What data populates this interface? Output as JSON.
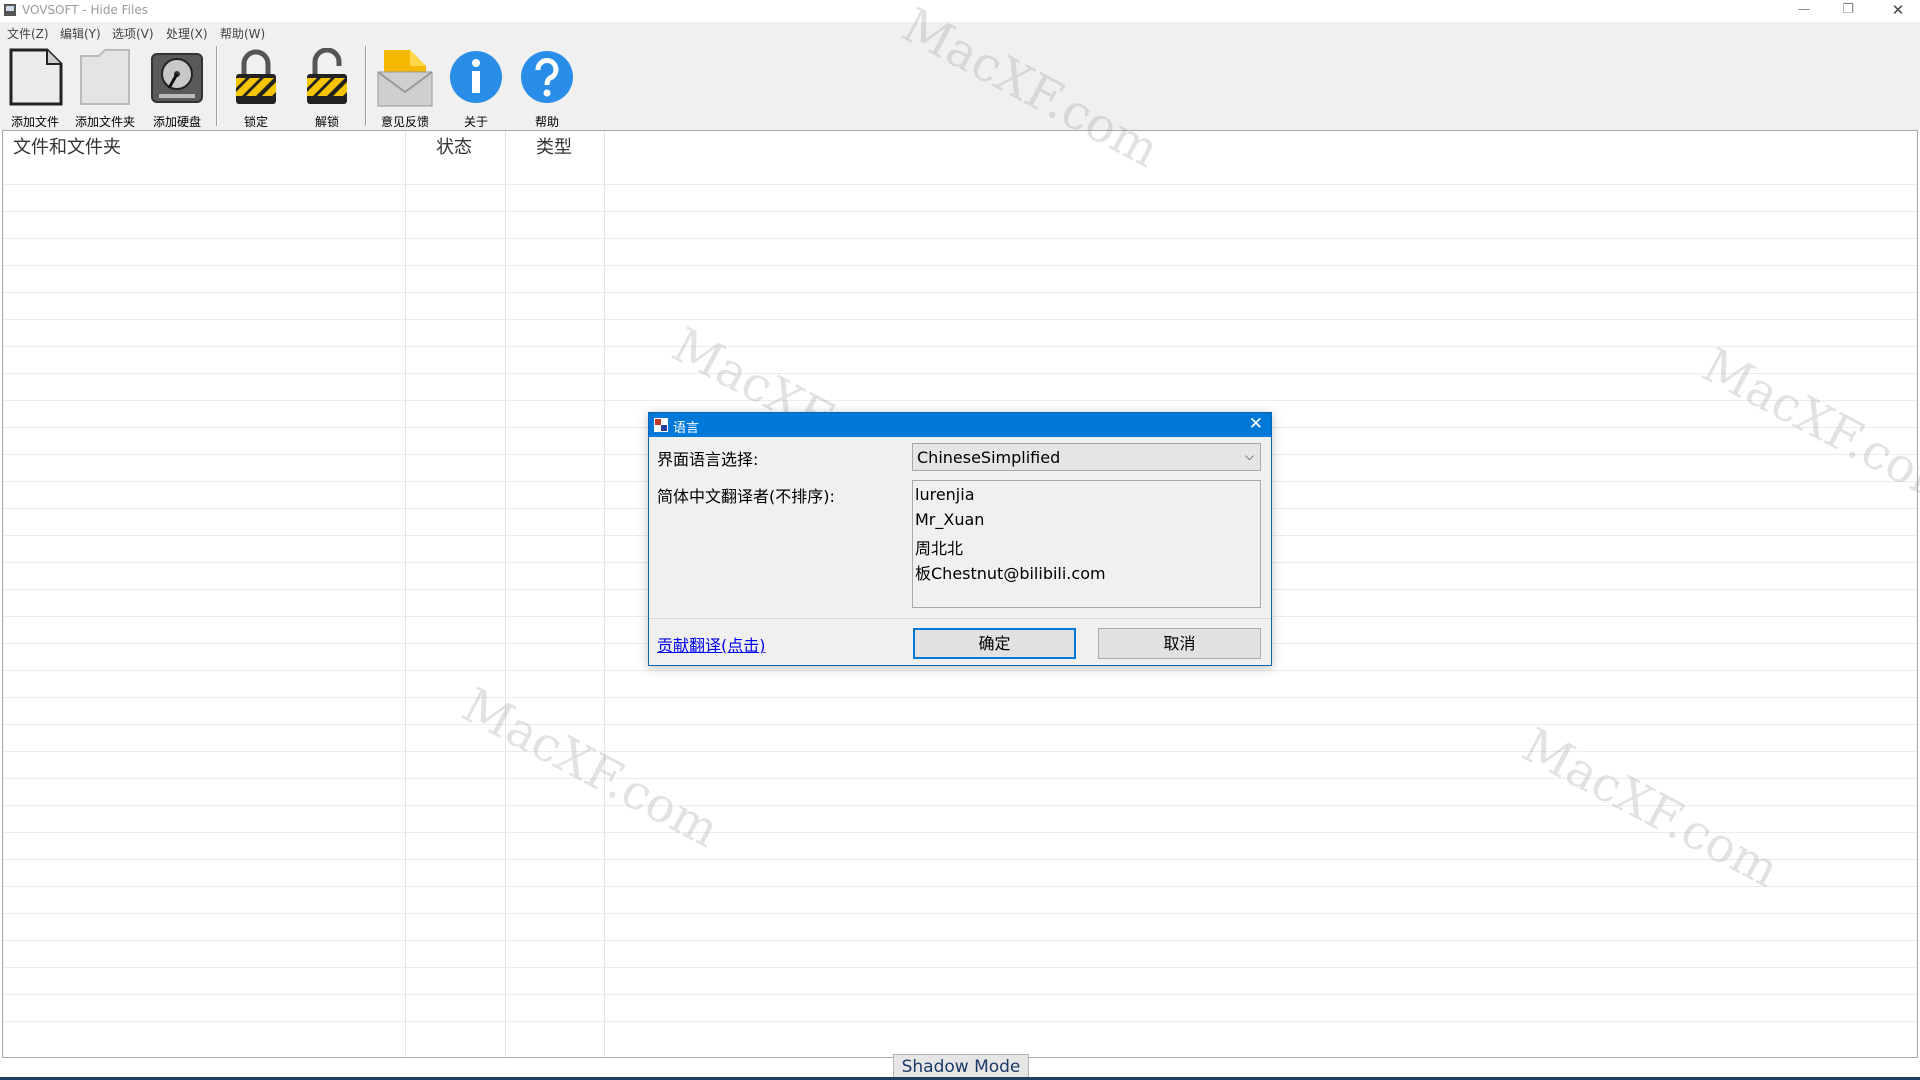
{
  "window": {
    "title": "VOVSOFT - Hide Files",
    "minimize_glyph": "—",
    "maximize_glyph": "❐",
    "close_glyph": "✕"
  },
  "menu": [
    {
      "label": "文件(Z)"
    },
    {
      "label": "编辑(Y)"
    },
    {
      "label": "选项(V)"
    },
    {
      "label": "处理(X)"
    },
    {
      "label": "帮助(W)"
    }
  ],
  "toolbar": {
    "add_file": "添加文件",
    "add_folder": "添加文件夹",
    "add_disk": "添加硬盘",
    "lock": "锁定",
    "unlock": "解锁",
    "feedback": "意见反馈",
    "about": "关于",
    "help": "帮助"
  },
  "list": {
    "columns": [
      "文件和文件夹",
      "状态",
      "类型"
    ],
    "rows": []
  },
  "status": {
    "shadow_mode": "Shadow Mode"
  },
  "dialog": {
    "title": "语言",
    "close_glyph": "✕",
    "language_label": "界面语言选择:",
    "language_value": "ChineseSimplified",
    "translators_label": "简体中文翻译者(不排序):",
    "translators": [
      "lurenjia",
      "Mr_Xuan",
      "周北北",
      "板Chestnut@bilibili.com"
    ],
    "contribute_link": "贡献翻译(点击)",
    "ok": "确定",
    "cancel": "取消"
  },
  "watermark": "MacXF.com",
  "colors": {
    "dialog_title_bg": "#0078d7",
    "link": "#0000ee"
  }
}
